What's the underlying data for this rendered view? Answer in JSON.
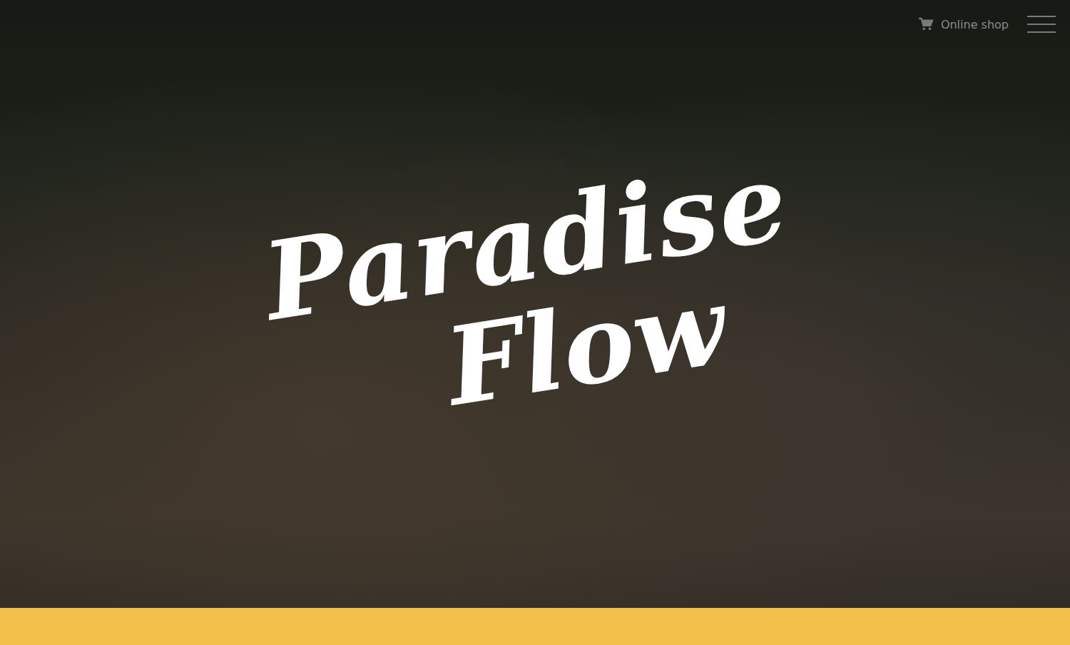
{
  "header": {
    "shop_label": "Online shop"
  },
  "logo": {
    "lines": [
      "Paradise",
      "Flow"
    ]
  }
}
